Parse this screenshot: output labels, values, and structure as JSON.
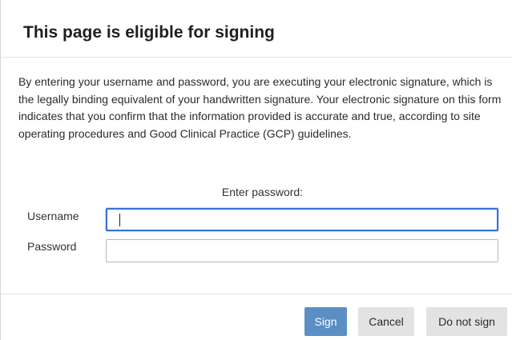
{
  "dialog": {
    "title": "This page is eligible for signing",
    "notice": "By entering your username and password, you are executing your electronic signature, which is the legally binding equivalent of your handwritten signature. Your electronic signature on this form indicates that you confirm that the information provided is accurate and true, according to site operating procedures and Good Clinical Practice (GCP) guidelines.",
    "prompt": "Enter password:"
  },
  "form": {
    "username_label": "Username",
    "username_value": "",
    "password_label": "Password",
    "password_value": ""
  },
  "buttons": {
    "sign": "Sign",
    "cancel": "Cancel",
    "do_not_sign": "Do not sign"
  },
  "colors": {
    "primary_button": "#5b8fc4",
    "secondary_button": "#e3e3e3",
    "focus_border": "#3a6fd8"
  }
}
